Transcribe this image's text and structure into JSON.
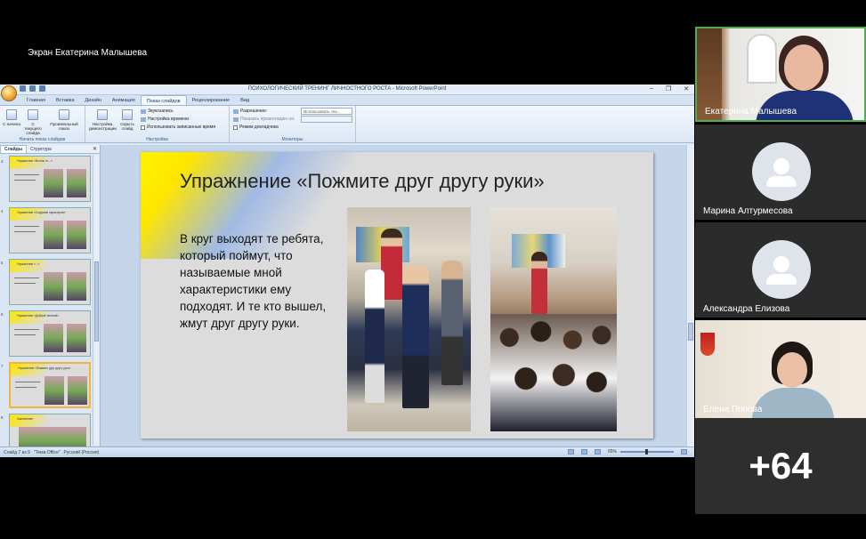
{
  "screen_share": {
    "caption": "Экран Екатерина Малышева"
  },
  "powerpoint": {
    "window_title": "ПСИХОЛОГИЧЕСКИЙ ТРЕНИНГ ЛИЧНОСТНОГО РОСТА - Microsoft PowerPoint",
    "tabs": [
      "Главная",
      "Вставка",
      "Дизайн",
      "Анимация",
      "Показ слайдов",
      "Рецензирование",
      "Вид"
    ],
    "active_tab": "Показ слайдов",
    "ribbon": {
      "group_start": {
        "title": "Начать показ слайдов",
        "btn_from_start": "С начала",
        "btn_from_current": "С текущего слайда",
        "btn_custom": "Произвольный показ"
      },
      "group_setup": {
        "title": "Настройка",
        "btn_setup": "Настройка демонстрации",
        "btn_hide": "Скрыть слайд",
        "record_narration": "Звукозапись",
        "rehearse_timings": "Настройка времени",
        "use_timings": "Использовать записанные время"
      },
      "group_monitors": {
        "title": "Мониторы",
        "resolution_label": "Разрешение:",
        "resolution_value": "Использовать тек...",
        "show_on_label": "Показать презентацию на:",
        "presenter_view": "Режим докладчика"
      }
    },
    "left_pane": {
      "tab_slides": "Слайды",
      "tab_outline": "Структура",
      "thumbs": [
        {
          "num": "3",
          "title": "Упражнение «Встань те...»"
        },
        {
          "num": "4",
          "title": "Упражнение «Создание характеров»"
        },
        {
          "num": "5",
          "title": "Упражнение «...»"
        },
        {
          "num": "6",
          "title": "Упражнение «Добрый теневой»"
        },
        {
          "num": "7",
          "title": "Упражнение «Пожмите друг другу руки»"
        },
        {
          "num": "8",
          "title": "Заключение"
        }
      ]
    },
    "slide": {
      "title": "Упражнение «Пожмите друг другу руки»",
      "body": "В круг выходят те ребята, который поймут, что называемые мной характеристики ему подходят. И те кто вышел, жмут друг другу руки."
    },
    "status": {
      "slide_of": "Слайд 7 из 9",
      "theme": "\"Тема Office\"",
      "language": "Русский (Россия)",
      "zoom": "65%"
    }
  },
  "participants": [
    {
      "name": "Екатерина Малышева"
    },
    {
      "name": "Марина Алтурмесова"
    },
    {
      "name": "Александра Елизова"
    },
    {
      "name": "Елена Попова"
    }
  ],
  "more_count": "+64"
}
